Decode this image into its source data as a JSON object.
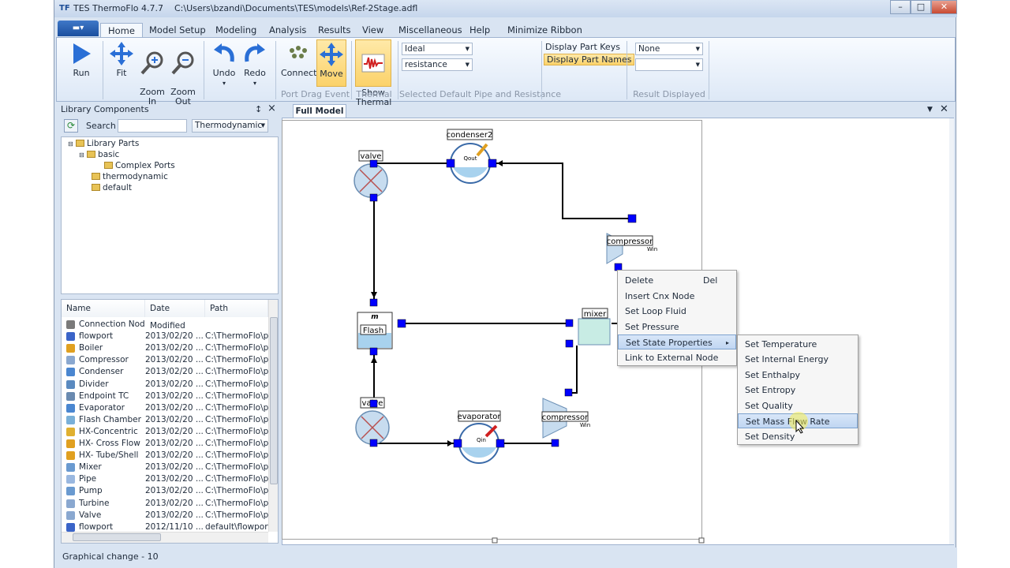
{
  "window": {
    "app_icon": "TF",
    "title": "TES ThermoFlo 4.7.7",
    "path": "C:\\Users\\bzandi\\Documents\\TES\\models\\Ref-2Stage.adfl"
  },
  "tabs": [
    "Home",
    "Model Setup",
    "Modeling",
    "Analysis",
    "Results",
    "View",
    "Miscellaneous",
    "Help",
    "Minimize Ribbon"
  ],
  "ribbon": {
    "run": "Run",
    "fit": "Fit",
    "zoom_in": "Zoom\nIn",
    "zoom_out": "Zoom\nOut",
    "undo": "Undo",
    "redo": "Redo",
    "connect": "Connect",
    "move": "Move",
    "show_thermal": "Show\nThermal",
    "group_port_drag": "Port Drag Event",
    "group_thermal": "Thermal",
    "pipe_select": "Ideal",
    "resistance_select": "resistance",
    "group_pipe": "Selected Default Pipe and Resistance",
    "display_part_keys": "Display Part Keys",
    "display_part_names": "Display Part Names",
    "result_select": "None",
    "result_select2": "",
    "group_result": "Result Displayed"
  },
  "library": {
    "title": "Library Components",
    "pin": "↕",
    "close": "×",
    "search_label": "Search",
    "search_value": "",
    "filter": "Thermodynamic",
    "tree": [
      "Library Parts",
      "basic",
      "Complex Ports",
      "thermodynamic",
      "default"
    ],
    "columns": [
      "Name",
      "Date Modified",
      "Path"
    ],
    "rows": [
      {
        "name": "Connection Node",
        "date": "",
        "path": "",
        "icon_color": "#7a7a7a"
      },
      {
        "name": "flowport",
        "date": "2013/02/20 ...",
        "path": "C:\\ThermoFlo\\p",
        "icon_color": "#3a64c8"
      },
      {
        "name": "Boiler",
        "date": "2013/02/20 ...",
        "path": "C:\\ThermoFlo\\p",
        "icon_color": "#e0a020"
      },
      {
        "name": "Compressor",
        "date": "2013/02/20 ...",
        "path": "C:\\ThermoFlo\\p",
        "icon_color": "#8aa8d0"
      },
      {
        "name": "Condenser",
        "date": "2013/02/20 ...",
        "path": "C:\\ThermoFlo\\p",
        "icon_color": "#4a86d0"
      },
      {
        "name": "Divider",
        "date": "2013/02/20 ...",
        "path": "C:\\ThermoFlo\\p",
        "icon_color": "#5a8ac0"
      },
      {
        "name": "Endpoint TC",
        "date": "2013/02/20 ...",
        "path": "C:\\ThermoFlo\\p",
        "icon_color": "#6a8ab0"
      },
      {
        "name": "Evaporator",
        "date": "2013/02/20 ...",
        "path": "C:\\ThermoFlo\\p",
        "icon_color": "#4a86d0"
      },
      {
        "name": "Flash Chamber",
        "date": "2013/02/20 ...",
        "path": "C:\\ThermoFlo\\p",
        "icon_color": "#7ab0d8"
      },
      {
        "name": "HX-Concentric",
        "date": "2013/02/20 ...",
        "path": "C:\\ThermoFlo\\p",
        "icon_color": "#e0b030"
      },
      {
        "name": "HX- Cross Flow",
        "date": "2013/02/20 ...",
        "path": "C:\\ThermoFlo\\p",
        "icon_color": "#e0a020"
      },
      {
        "name": "HX- Tube/Shell",
        "date": "2013/02/20 ...",
        "path": "C:\\ThermoFlo\\p",
        "icon_color": "#e0a020"
      },
      {
        "name": "Mixer",
        "date": "2013/02/20 ...",
        "path": "C:\\ThermoFlo\\p",
        "icon_color": "#6a9ad0"
      },
      {
        "name": "Pipe",
        "date": "2013/02/20 ...",
        "path": "C:\\ThermoFlo\\p",
        "icon_color": "#9ab8e0"
      },
      {
        "name": "Pump",
        "date": "2013/02/20 ...",
        "path": "C:\\ThermoFlo\\p",
        "icon_color": "#6a9ad0"
      },
      {
        "name": "Turbine",
        "date": "2013/02/20 ...",
        "path": "C:\\ThermoFlo\\p",
        "icon_color": "#8aa8d0"
      },
      {
        "name": "Valve",
        "date": "2013/02/20 ...",
        "path": "C:\\ThermoFlo\\p",
        "icon_color": "#8aa8d0"
      },
      {
        "name": "flowport",
        "date": "2012/11/10 ...",
        "path": "default\\flowport",
        "icon_color": "#3a64c8"
      }
    ]
  },
  "document": {
    "tab": "Full Model"
  },
  "model": {
    "labels": {
      "valve_top": "valve",
      "condenser": "condenser2",
      "compressor_top": "compressor",
      "flash": "Flash",
      "mixer": "mixer",
      "valve_bottom": "valve",
      "evaporator": "evaporator",
      "compressor_bottom": "compressor",
      "q_out": "Qout",
      "q_in": "Qin",
      "w_in": "Win",
      "m_dot": "m"
    }
  },
  "context_menu": {
    "items": [
      {
        "label": "Delete",
        "shortcut": "Del"
      },
      {
        "label": "Insert Cnx Node",
        "shortcut": ""
      },
      {
        "label": "Set Loop Fluid",
        "shortcut": ""
      },
      {
        "label": "Set Pressure",
        "shortcut": ""
      },
      {
        "label": "Set State Properties",
        "shortcut": "▸"
      },
      {
        "label": "Link to External Node",
        "shortcut": ""
      }
    ],
    "submenu": [
      "Set Temperature",
      "Set Internal Energy",
      "Set Enthalpy",
      "Set Entropy",
      "Set Quality",
      "Set Mass Flow Rate",
      "Set Density"
    ],
    "highlighted": "Set Mass Flow Rate"
  },
  "status": "Graphical change - 10"
}
